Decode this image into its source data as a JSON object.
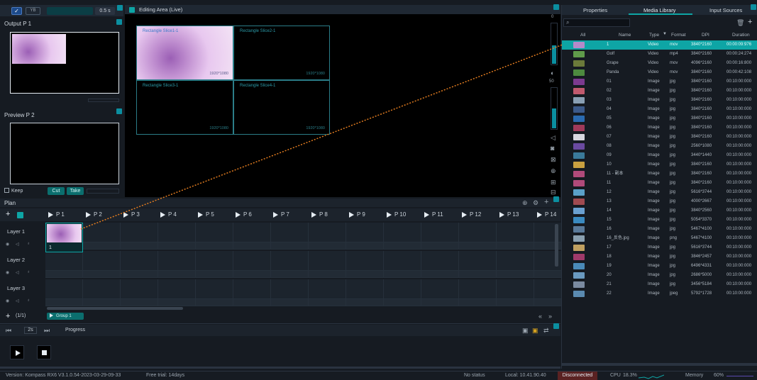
{
  "toolbar": {
    "output_toggle": "YB",
    "transition_time": "0.5 s"
  },
  "output_panel": {
    "title": "Output  P 1"
  },
  "preview_panel": {
    "title": "Preview  P 2",
    "keep_label": "Keep",
    "cut_label": "Cut",
    "take_label": "Take"
  },
  "editing_area": {
    "title": "Editing Area (Live)",
    "slices": [
      {
        "name": "Rectangle Slice1-1",
        "res": "1920*1080"
      },
      {
        "name": "Rectangle Slice2-1",
        "res": "1920*1080"
      },
      {
        "name": "Rectangle Slice3-1",
        "res": "1920*1080"
      },
      {
        "name": "Rectangle Slice4-1",
        "res": "1920*1080"
      }
    ],
    "scale_top": "0",
    "scale_mid": "50"
  },
  "plan": {
    "title": "Plan",
    "pages": [
      "P 1",
      "P 2",
      "P 3",
      "P 4",
      "P 5",
      "P 6",
      "P 7",
      "P 8",
      "P 9",
      "P 10",
      "P 11",
      "P 12",
      "P 13",
      "P 14"
    ],
    "layers": [
      "Layer 1",
      "Layer 2",
      "Layer 3"
    ],
    "clip_label": "1",
    "page_count": "(1/1)",
    "group_label": "Group 1"
  },
  "transport": {
    "speed": "2s",
    "progress_label": "Progress"
  },
  "right_panel": {
    "tabs": [
      "Properties",
      "Media Library",
      "Input Sources"
    ],
    "filter_all": "All",
    "columns": [
      "Name",
      "Type",
      "Format",
      "DPI",
      "Duration"
    ],
    "rows": [
      {
        "name": "1",
        "type": "Video",
        "format": "mov",
        "dpi": "3840*2160",
        "duration": "00:00:09:976",
        "thumb": "#b58ac9"
      },
      {
        "name": "Golf",
        "type": "Video",
        "format": "mp4",
        "dpi": "3840*2160",
        "duration": "00:00:24:274",
        "thumb": "#5f9b4a"
      },
      {
        "name": "Grape",
        "type": "Video",
        "format": "mov",
        "dpi": "4096*2160",
        "duration": "00:00:16:800",
        "thumb": "#6b7a3a"
      },
      {
        "name": "Panda",
        "type": "Video",
        "format": "mov",
        "dpi": "3840*2160",
        "duration": "00:00:42:108",
        "thumb": "#4d8a3f"
      },
      {
        "name": "01",
        "type": "Image",
        "format": "jpg",
        "dpi": "3840*2160",
        "duration": "00:10:00:000",
        "thumb": "#7c3a8f"
      },
      {
        "name": "02",
        "type": "Image",
        "format": "jpg",
        "dpi": "3840*2160",
        "duration": "00:10:00:000",
        "thumb": "#c05a6e"
      },
      {
        "name": "03",
        "type": "Image",
        "format": "jpg",
        "dpi": "3840*2160",
        "duration": "00:10:00:000",
        "thumb": "#8aa0b4"
      },
      {
        "name": "04",
        "type": "Image",
        "format": "jpg",
        "dpi": "3840*2160",
        "duration": "00:10:00:000",
        "thumb": "#3c5a8a"
      },
      {
        "name": "05",
        "type": "Image",
        "format": "jpg",
        "dpi": "3840*2160",
        "duration": "00:10:00:000",
        "thumb": "#2a6ab0"
      },
      {
        "name": "06",
        "type": "Image",
        "format": "jpg",
        "dpi": "3840*2160",
        "duration": "00:10:00:000",
        "thumb": "#a03a5a"
      },
      {
        "name": "07",
        "type": "Image",
        "format": "jpg",
        "dpi": "3840*2160",
        "duration": "00:10:00:000",
        "thumb": "#d8d8e0"
      },
      {
        "name": "08",
        "type": "Image",
        "format": "jpg",
        "dpi": "2560*1080",
        "duration": "00:10:00:000",
        "thumb": "#6a4aa0"
      },
      {
        "name": "09",
        "type": "Image",
        "format": "jpg",
        "dpi": "3440*1440",
        "duration": "00:10:00:000",
        "thumb": "#3a7a9a"
      },
      {
        "name": "10",
        "type": "Image",
        "format": "jpg",
        "dpi": "3840*2160",
        "duration": "00:10:00:000",
        "thumb": "#c8a040"
      },
      {
        "name": "11 - 副本",
        "type": "Image",
        "format": "jpg",
        "dpi": "3840*2160",
        "duration": "00:10:00:000",
        "thumb": "#b04a7a"
      },
      {
        "name": "11",
        "type": "Image",
        "format": "jpg",
        "dpi": "3840*2160",
        "duration": "00:10:00:000",
        "thumb": "#b04a7a"
      },
      {
        "name": "12",
        "type": "Image",
        "format": "jpg",
        "dpi": "5616*3744",
        "duration": "00:10:00:000",
        "thumb": "#5aa0c8"
      },
      {
        "name": "13",
        "type": "Image",
        "format": "jpg",
        "dpi": "4000*2667",
        "duration": "00:10:00:000",
        "thumb": "#a04a50"
      },
      {
        "name": "14",
        "type": "Image",
        "format": "jpg",
        "dpi": "3840*2560",
        "duration": "00:10:00:000",
        "thumb": "#6aa0d0"
      },
      {
        "name": "15",
        "type": "Image",
        "format": "jpg",
        "dpi": "5054*3370",
        "duration": "00:10:00:000",
        "thumb": "#3a8ac0"
      },
      {
        "name": "16",
        "type": "Image",
        "format": "jpg",
        "dpi": "5467*4100",
        "duration": "00:10:00:000",
        "thumb": "#5a7a9a"
      },
      {
        "name": "16_反色.jpg",
        "type": "Image",
        "format": "png",
        "dpi": "5467*4100",
        "duration": "00:10:00:000",
        "thumb": "#8aa0b0"
      },
      {
        "name": "17",
        "type": "Image",
        "format": "jpg",
        "dpi": "5616*3744",
        "duration": "00:10:00:000",
        "thumb": "#c0a060"
      },
      {
        "name": "18",
        "type": "Image",
        "format": "jpg",
        "dpi": "3846*2457",
        "duration": "00:10:00:000",
        "thumb": "#a03a6a"
      },
      {
        "name": "19",
        "type": "Image",
        "format": "jpg",
        "dpi": "6496*4331",
        "duration": "00:10:00:000",
        "thumb": "#4a8ab8"
      },
      {
        "name": "20",
        "type": "Image",
        "format": "jpg",
        "dpi": "2686*5000",
        "duration": "00:10:00:000",
        "thumb": "#6a9ac0"
      },
      {
        "name": "21",
        "type": "Image",
        "format": "jpg",
        "dpi": "3456*5184",
        "duration": "00:10:00:000",
        "thumb": "#7a8aa0"
      },
      {
        "name": "22",
        "type": "Image",
        "format": "jpeg",
        "dpi": "5792*1728",
        "duration": "00:10:00:000",
        "thumb": "#5a8ab0"
      }
    ]
  },
  "status_bar": {
    "version": "Version: Kompass RX6 V3.1.0.54-2023-03-29-09-33",
    "trial": "Free trial: 14days",
    "status": "No status",
    "local": "Local: 10.41.90.40",
    "connection": "Disconnected",
    "cpu_label": "CPU",
    "cpu_value": "18.3%",
    "memory_label": "Memory",
    "memory_value": "60%"
  },
  "colors": {
    "accent": "#0ea5a5",
    "background": "#161b22",
    "panel": "#0d1117",
    "selected_row": "#0ea5a5",
    "disconnected": "#5a2222",
    "connector": "#e07b1f"
  }
}
